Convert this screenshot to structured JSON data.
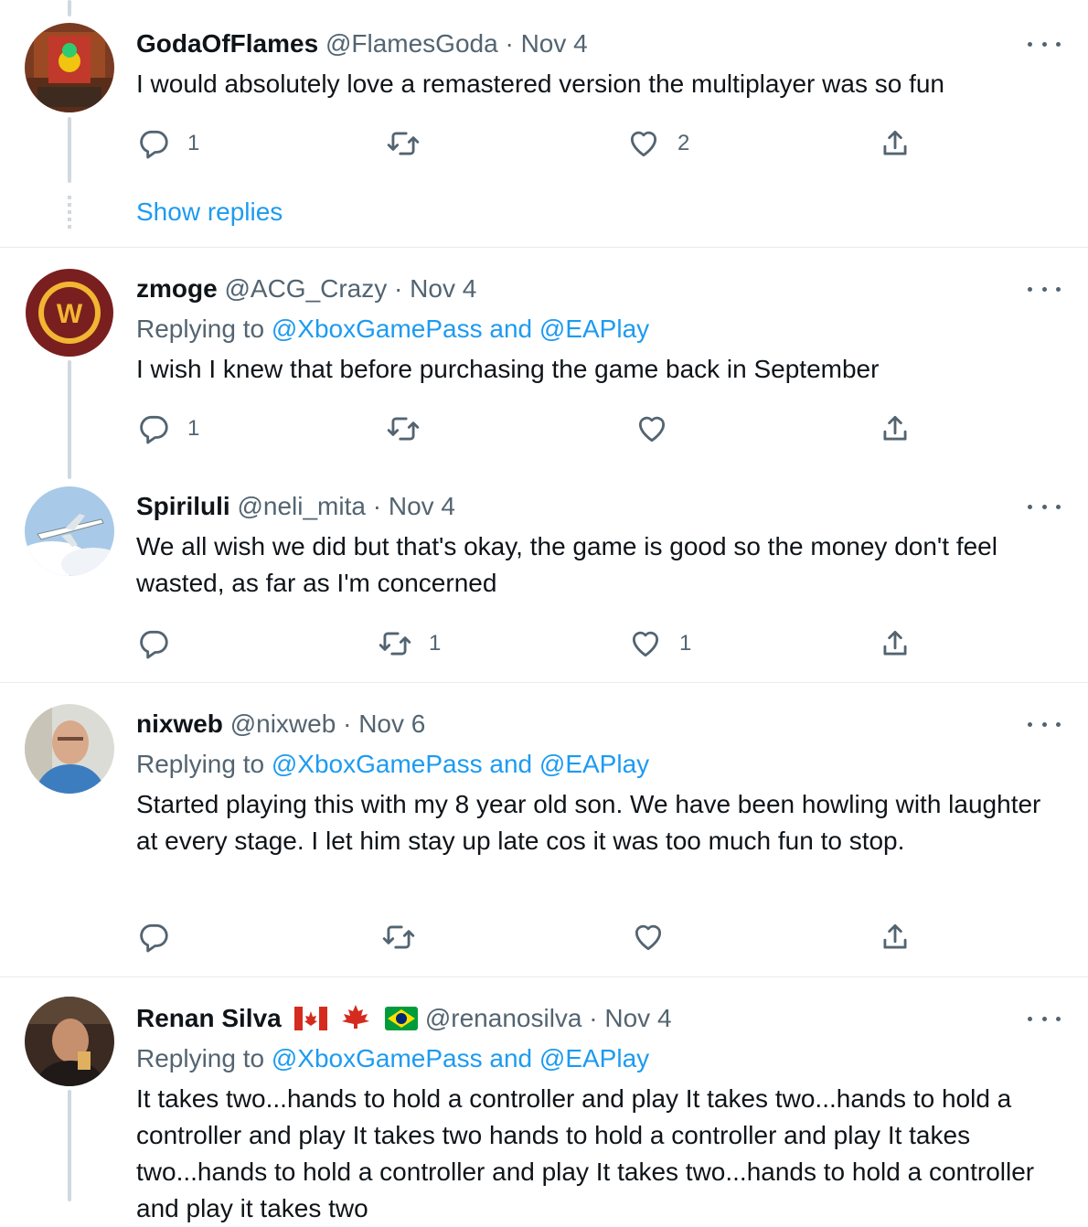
{
  "tweets": [
    {
      "name": "GodaOfFlames",
      "handle": "@FlamesGoda",
      "date": "Nov 4",
      "text": "I would absolutely love a remastered version the multiplayer was so fun",
      "replies": "1",
      "retweets": "",
      "likes": "2"
    },
    {
      "name": "zmoge",
      "handle": "@ACG_Crazy",
      "date": "Nov 4",
      "replying_prefix": "Replying to",
      "replying_to": "@XboxGamePass and @EAPlay",
      "text": "I wish I knew that before purchasing the game back in September",
      "replies": "1",
      "retweets": "",
      "likes": ""
    },
    {
      "name": "Spiriluli",
      "handle": "@neli_mita",
      "date": "Nov 4",
      "text": "We all wish we did but that's okay, the game is good so the money don't feel wasted, as far as I'm concerned",
      "replies": "",
      "retweets": "1",
      "likes": "1"
    },
    {
      "name": "nixweb",
      "handle": "@nixweb",
      "date": "Nov 6",
      "replying_prefix": "Replying to",
      "replying_to": "@XboxGamePass and @EAPlay",
      "text": "Started playing this with my 8 year old son. We have been howling with laughter at every stage. I let him stay up late cos it was too much fun to stop.",
      "replies": "",
      "retweets": "",
      "likes": ""
    },
    {
      "name": "Renan Silva",
      "handle": "@renanosilva",
      "date": "Nov 4",
      "replying_prefix": "Replying to",
      "replying_to": "@XboxGamePass and @EAPlay",
      "text": "It takes two...hands to hold a controller and play It takes two...hands to hold a controller and play It takes two hands to hold a controller and play It takes two...hands to hold a controller and play It takes two...hands to hold a controller and play it takes two"
    }
  ],
  "show_replies": "Show replies",
  "separator_dot": "·",
  "icons": [
    "reply-icon",
    "retweet-icon",
    "like-icon",
    "share-icon",
    "more-icon"
  ],
  "colors": {
    "link": "#1d9bf0",
    "muted": "#536471",
    "text": "#0f1419",
    "thread": "#cfd9de",
    "border": "#e7ecf0"
  }
}
